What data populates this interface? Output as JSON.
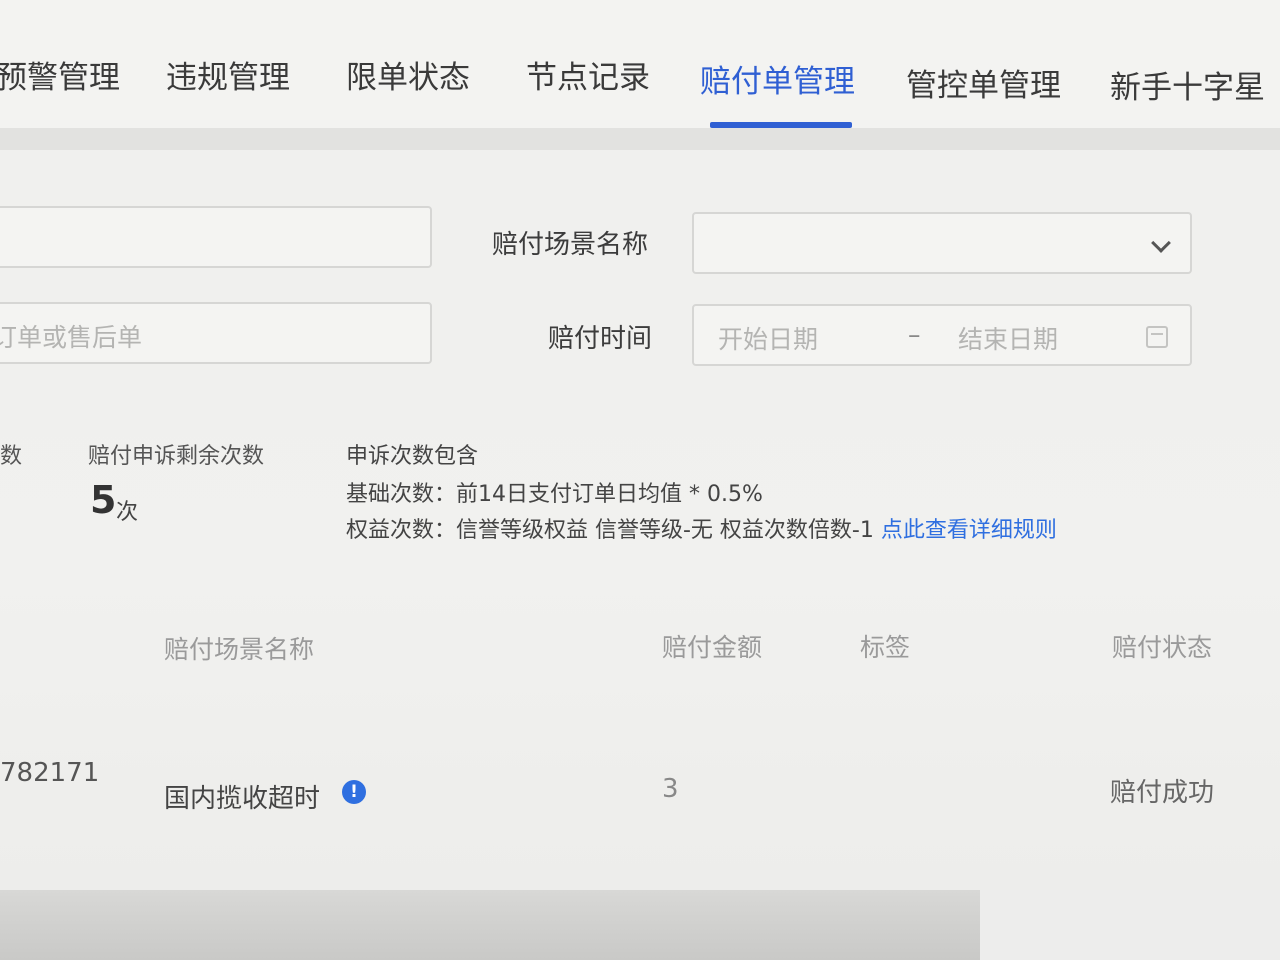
{
  "tabs": [
    {
      "label": "预警管理",
      "active": false
    },
    {
      "label": "违规管理",
      "active": false
    },
    {
      "label": "限单状态",
      "active": false
    },
    {
      "label": "节点记录",
      "active": false
    },
    {
      "label": "赔付单管理",
      "active": true
    },
    {
      "label": "管控单管理",
      "active": false
    },
    {
      "label": "新手十字星",
      "active": false
    }
  ],
  "form": {
    "order_input_placeholder": "订单或售后单",
    "scene_label": "赔付场景名称",
    "scene_select_value": "",
    "time_label": "赔付时间",
    "start_date_placeholder": "开始日期",
    "date_separator": "–",
    "end_date_placeholder": "结束日期"
  },
  "stats": {
    "partial_label": "数",
    "remaining_label": "赔付申诉剩余次数",
    "remaining_value": "5",
    "remaining_unit": "次",
    "includes_title": "申诉次数包含",
    "base_line": "基础次数：前14日支付订单日均值 * 0.5%",
    "rights_line": "权益次数：信誉等级权益 信誉等级-无 权益次数倍数-1",
    "rules_link": "点此查看详细规则"
  },
  "table": {
    "headers": {
      "scene": "赔付场景名称",
      "amount": "赔付金额",
      "tag": "标签",
      "status": "赔付状态"
    },
    "rows": [
      {
        "id": "782171",
        "scene": "国内揽收超时",
        "amount": "3",
        "tag": "",
        "status": "赔付成功"
      }
    ]
  },
  "colors": {
    "accent": "#2f5fd3",
    "link": "#2f6fe0"
  }
}
